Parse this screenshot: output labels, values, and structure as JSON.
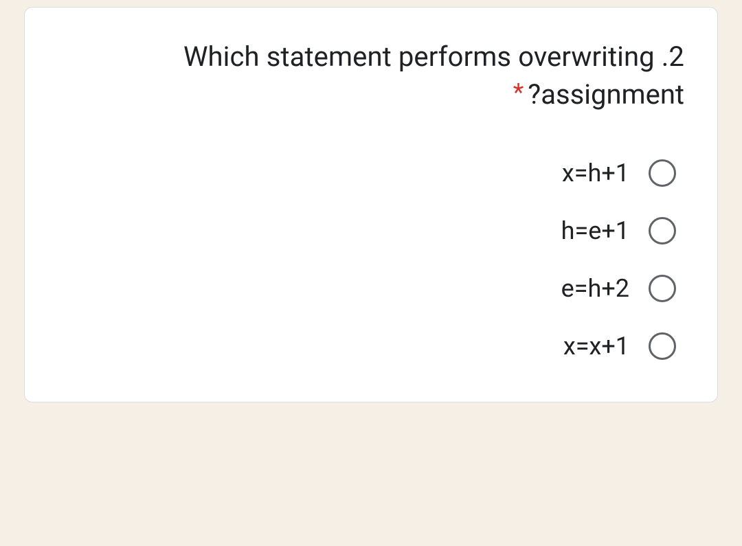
{
  "question": {
    "line1": "Which statement performs overwriting .2",
    "line2": "?assignment",
    "required_marker": "*"
  },
  "options": [
    {
      "label": "x=h+1"
    },
    {
      "label": "h=e+1"
    },
    {
      "label": "e=h+2"
    },
    {
      "label": "x=x+1"
    }
  ]
}
